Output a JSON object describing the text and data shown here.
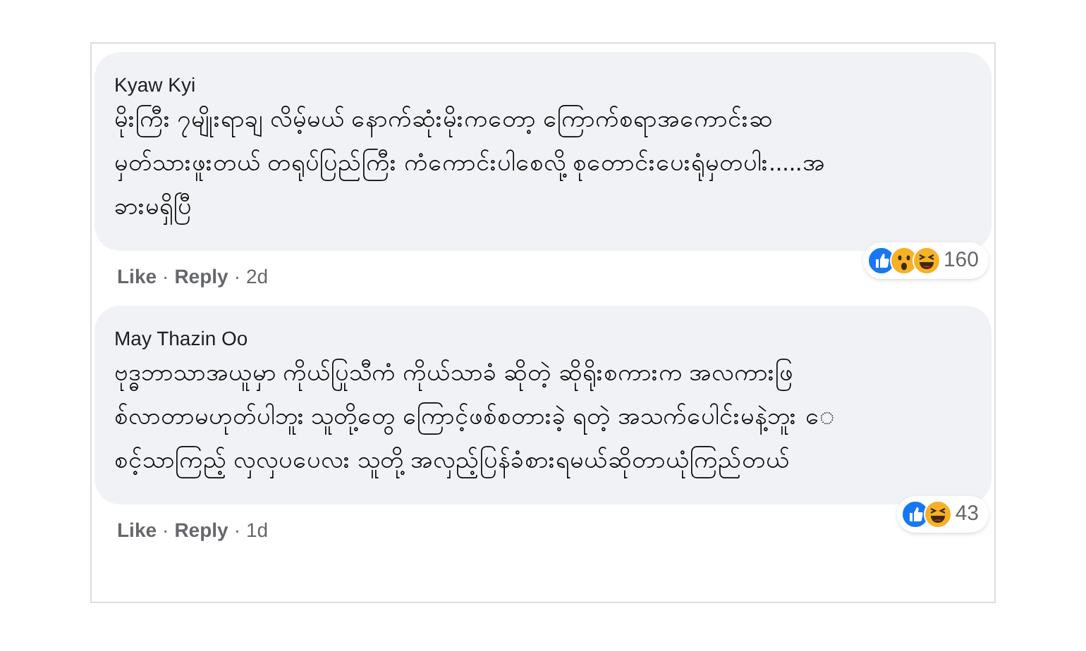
{
  "comments": [
    {
      "author": "Kyaw Kyi",
      "lines": [
        "မိုးကြီး ၇မျိုးရာချ လိမ့်မယ် နောက်ဆုံးမိုးကတော့ ကြောက်စရာအကောင်းဆ",
        "မှတ်သားဖူးတယ် တရုပ်ပြည်ကြီး ကံကောင်းပါစေလို့ စုတောင်းပေးရုံမှတပါး.....အ",
        "ခားမရှိပြီ"
      ],
      "reactions": [
        {
          "kind": "like"
        },
        {
          "kind": "wow"
        },
        {
          "kind": "haha"
        }
      ],
      "reaction_count": "160",
      "footer": [
        {
          "kind": "link",
          "text": "Like"
        },
        {
          "kind": "dot",
          "text": "·"
        },
        {
          "kind": "link",
          "text": "Reply"
        },
        {
          "kind": "dot",
          "text": "·"
        },
        {
          "kind": "time",
          "text": "2d"
        }
      ]
    },
    {
      "author": "May Thazin Oo",
      "lines": [
        "ဗုဒ္ဓဘာသာအယူမှာ ကိုယ်ပြုသီကံ ကိုယ်သာခံ ဆိုတဲ့ ဆိုရိုးစကားက အလကားဖြ",
        "စ်လာတာမဟုတ်ပါဘူး သူတို့တွေ ကြောင့်ဖစ်စတားခဲ့ ရတဲ့ အသက်ပေါင်းမနဲ့ဘူး ေ",
        "စင့်သာကြည့် လှလှပပေလး သူတို့ အလှည့်ပြန်ခံစားရမယ်ဆိုတာယုံကြည်တယ်"
      ],
      "reactions": [
        {
          "kind": "like"
        },
        {
          "kind": "haha"
        }
      ],
      "reaction_count": "43",
      "footer": [
        {
          "kind": "link",
          "text": "Like"
        },
        {
          "kind": "dot",
          "text": "·"
        },
        {
          "kind": "link",
          "text": "Reply"
        },
        {
          "kind": "dot",
          "text": "·"
        },
        {
          "kind": "time",
          "text": "1d"
        }
      ]
    }
  ]
}
